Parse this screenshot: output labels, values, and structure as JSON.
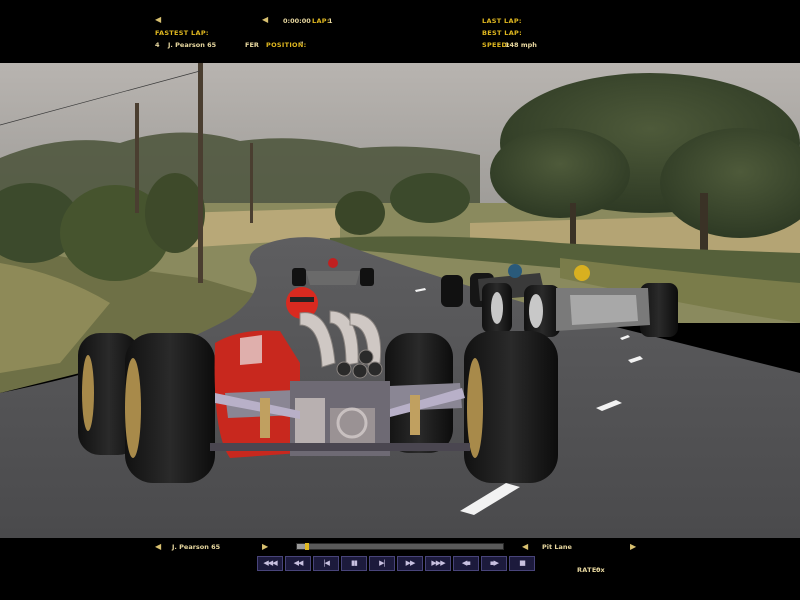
{
  "hud_top": {
    "time": "0:00:00",
    "lap_label": "Lap:",
    "lap_value": "1",
    "fastest_lap_label": "Fastest Lap:",
    "fastest_lap_number": "4",
    "fastest_lap_driver": "J. Pearson 65",
    "fastest_lap_team": "FER",
    "position_label": "Position:",
    "position_value": "\"",
    "last_lap_label": "Last Lap:",
    "best_lap_label": "Best Lap:",
    "speed_label": "Speed:",
    "speed_value": "148 mph"
  },
  "hud_bottom": {
    "driver": "J. Pearson 65",
    "location": "Pit Lane",
    "rate_label": "Rate:",
    "rate_value": "0x",
    "replay_progress": 0.05,
    "controls": [
      {
        "name": "skip-to-start-button",
        "glyph": "◀◀◀"
      },
      {
        "name": "fast-rewind-button",
        "glyph": "◀◀"
      },
      {
        "name": "rewind-button",
        "glyph": "|◀"
      },
      {
        "name": "pause-button",
        "glyph": "▮▮"
      },
      {
        "name": "step-forward-button",
        "glyph": "▶|"
      },
      {
        "name": "fast-forward-button",
        "glyph": "▶▶"
      },
      {
        "name": "skip-to-end-button",
        "glyph": "▶▶▶"
      },
      {
        "name": "previous-camera-button",
        "glyph": "◀▪"
      },
      {
        "name": "next-camera-button",
        "glyph": "▪▶"
      },
      {
        "name": "stop-button",
        "glyph": "■"
      }
    ]
  },
  "colors": {
    "hud_label": "#e0b820",
    "hud_value": "#e8d8a0",
    "button_bg": "#1c1a3c"
  }
}
